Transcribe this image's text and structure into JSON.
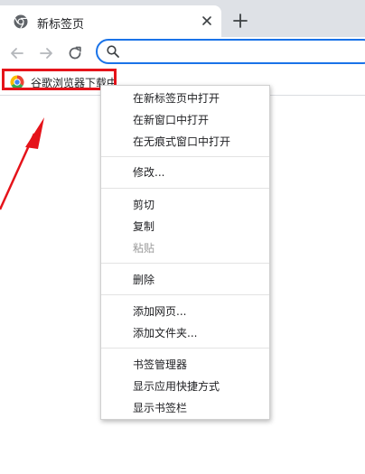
{
  "tab": {
    "title": "新标签页",
    "favicon_icon": "chrome-icon",
    "close_icon": "close-icon"
  },
  "new_tab_icon": "plus-icon",
  "toolbar": {
    "back_icon": "arrow-left-icon",
    "forward_icon": "arrow-right-icon",
    "reload_icon": "reload-icon",
    "omnibox": {
      "value": "",
      "icon": "search-icon"
    }
  },
  "bookmarks": {
    "items": [
      {
        "label": "谷歌浏览器下载中",
        "icon": "chrome-icon"
      }
    ]
  },
  "context_menu": {
    "groups": [
      [
        {
          "label": "在新标签页中打开",
          "enabled": true
        },
        {
          "label": "在新窗口中打开",
          "enabled": true
        },
        {
          "label": "在无痕式窗口中打开",
          "enabled": true
        }
      ],
      [
        {
          "label": "修改...",
          "enabled": true
        }
      ],
      [
        {
          "label": "剪切",
          "enabled": true
        },
        {
          "label": "复制",
          "enabled": true
        },
        {
          "label": "粘贴",
          "enabled": false
        }
      ],
      [
        {
          "label": "删除",
          "enabled": true
        }
      ],
      [
        {
          "label": "添加网页...",
          "enabled": true
        },
        {
          "label": "添加文件夹...",
          "enabled": true
        }
      ],
      [
        {
          "label": "书签管理器",
          "enabled": true
        },
        {
          "label": "显示应用快捷方式",
          "enabled": true
        },
        {
          "label": "显示书签栏",
          "enabled": true
        }
      ]
    ]
  },
  "colors": {
    "tabstrip_bg": "#dee1e6",
    "omnibox_focus": "#1a73e8",
    "annotation_red": "#e5131a",
    "disabled_text": "#9a9a9a"
  }
}
